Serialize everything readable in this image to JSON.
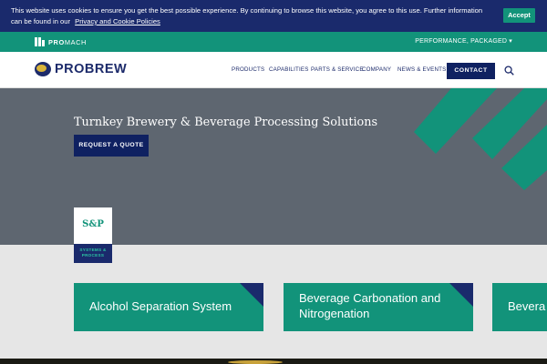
{
  "cookie_banner": {
    "text": "This website uses cookies to ensure you get the best possible experience. By continuing to browse this website, you agree to this use. Further information can be found in our",
    "link_label": "Privacy and Cookie Policies",
    "accept_label": "Accept"
  },
  "promach_bar": {
    "logo_bold": "PRO",
    "logo_light": "MACH",
    "tagline": "PERFORMANCE, PACKAGED ▾"
  },
  "header": {
    "brand": "PROBREW",
    "nav": [
      "PRODUCTS",
      "CAPABILITIES",
      "PARTS & SERVICE",
      "COMPANY",
      "NEWS & EVENTS"
    ],
    "contact_label": "CONTACT"
  },
  "hero": {
    "title": "Turnkey Brewery & Beverage Processing Solutions",
    "cta_label": "REQUEST A QUOTE"
  },
  "badge": {
    "mark": "S&P",
    "line1": "SYSTEMS &",
    "line2": "PROCESS"
  },
  "cards": [
    {
      "label": "Alcohol Separation System"
    },
    {
      "label": "Beverage Carbonation and Nitrogenation"
    },
    {
      "label": "Bevera"
    }
  ],
  "colors": {
    "navy": "#1a2a6c",
    "teal": "#12937a",
    "slate": "#5e6670"
  },
  "icons": [
    "search-icon",
    "promach-bars-icon",
    "probrew-emblem-icon"
  ]
}
